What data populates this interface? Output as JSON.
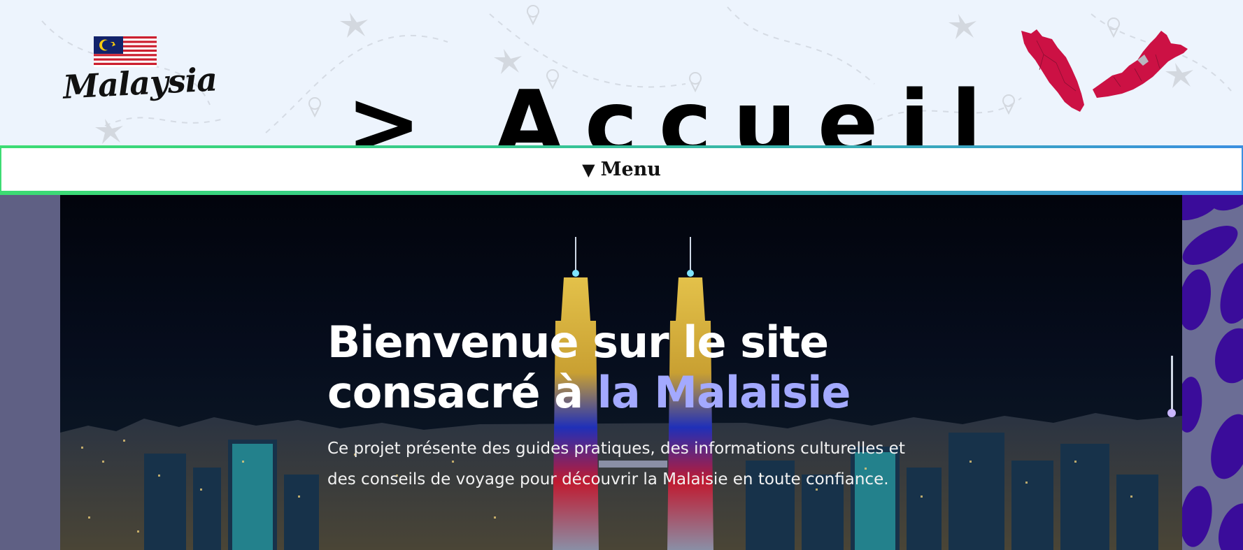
{
  "header": {
    "logo_text": "Malaysia",
    "title": "> Accueil"
  },
  "menu": {
    "toggle_arrow": "▼",
    "toggle_label": "Menu"
  },
  "hero": {
    "title_line1": "Bienvenue sur le site",
    "title_line2_start": "consacré à ",
    "title_line2_accent": "la Malaisie",
    "description": "Ce projet présente des guides pratiques, des informations culturelles et des conseils de voyage pour découvrir la Malaisie en toute confiance."
  },
  "colors": {
    "header_bg": "#edf4fd",
    "menu_border_start": "#3ddc73",
    "menu_border_end": "#3b8fe0",
    "accent": "#a3a9ff",
    "map_red": "#cc1144",
    "side_purple": "#3a0c9a"
  },
  "icons": {
    "flag": "malaysia-flag-icon",
    "map": "malaysia-map-icon",
    "arrow": "triangle-down-icon"
  }
}
